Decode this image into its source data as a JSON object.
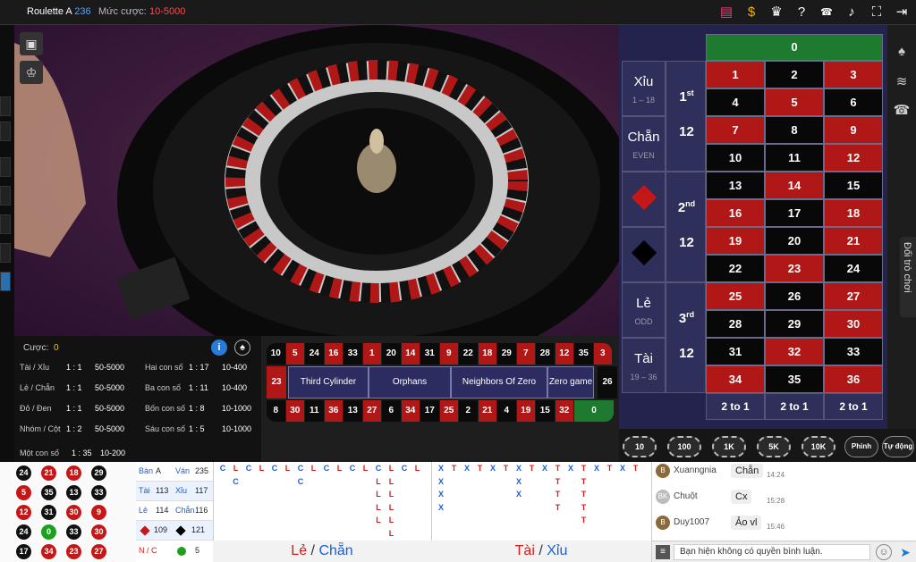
{
  "topbar": {
    "title": "Roulette A",
    "table_id": "236",
    "bet_label": "Mức cược:",
    "bet_range": "10-5000"
  },
  "betinfo": {
    "cuoc_label": "Cược:",
    "cuoc_value": "0",
    "rows": [
      {
        "name": "Tài / Xỉu",
        "ratio": "1 : 1",
        "range": "50-5000",
        "name2": "Hai con số",
        "ratio2": "1 : 17",
        "range2": "10-400"
      },
      {
        "name": "Lẻ / Chẵn",
        "ratio": "1 : 1",
        "range": "50-5000",
        "name2": "Ba con số",
        "ratio2": "1 : 11",
        "range2": "10-400"
      },
      {
        "name": "Đỏ / Đen",
        "ratio": "1 : 1",
        "range": "50-5000",
        "name2": "Bốn con số",
        "ratio2": "1 : 8",
        "range2": "10-1000"
      },
      {
        "name": "Nhóm / Cột",
        "ratio": "1 : 2",
        "range": "50-5000",
        "name2": "Sáu con số",
        "ratio2": "1 : 5",
        "range2": "10-1000"
      }
    ],
    "single": {
      "name": "Một con số",
      "ratio": "1 : 35",
      "range": "10-200"
    }
  },
  "racetrack": {
    "top": [
      "10",
      "5",
      "24",
      "16",
      "33",
      "1",
      "20",
      "14",
      "31",
      "9",
      "22",
      "18",
      "29",
      "7",
      "28",
      "12",
      "35",
      "3"
    ],
    "bottom": [
      "8",
      "30",
      "11",
      "36",
      "13",
      "27",
      "6",
      "34",
      "17",
      "25",
      "2",
      "21",
      "4",
      "19",
      "15",
      "32",
      "0"
    ],
    "left": "23",
    "right": "26",
    "sections": [
      "Third Cylinder",
      "Orphans",
      "Neighbors Of Zero",
      "Zero game"
    ]
  },
  "board": {
    "zero": "0",
    "sides": {
      "xiu": "Xỉu",
      "xiu_sub": "1 – 18",
      "chan": "Chẵn",
      "chan_sub": "EVEN",
      "le": "Lẻ",
      "le_sub": "ODD",
      "tai": "Tài",
      "tai_sub": "19 – 36"
    },
    "dozens": [
      {
        "ord": "1",
        "sup": "st",
        "n": "12"
      },
      {
        "ord": "2",
        "sup": "nd",
        "n": "12"
      },
      {
        "ord": "3",
        "sup": "rd",
        "n": "12"
      }
    ],
    "payout": "2 to 1"
  },
  "chips": [
    "10",
    "100",
    "1K",
    "5K",
    "10K"
  ],
  "chip_buttons": {
    "repeat": "Phinh",
    "auto": "Tự động"
  },
  "side_tab": "Đổi trò chơi",
  "history": {
    "stats": {
      "ban": "Bàn",
      "ban_v": "A",
      "van": "Ván",
      "van_v": "235",
      "tai": "Tài",
      "tai_v": "113",
      "xiu": "Xỉu",
      "xiu_v": "117",
      "le": "Lẻ",
      "le_v": "114",
      "chan": "Chẵn",
      "chan_v": "116",
      "red_v": "109",
      "black_v": "121",
      "nc": "N / C",
      "green_v": "5"
    },
    "label_left_a": "Lẻ",
    "label_left_sep": " / ",
    "label_left_b": "Chẵn",
    "label_right_a": "Tài",
    "label_right_sep": " / ",
    "label_right_b": "Xỉu"
  },
  "chat": {
    "messages": [
      {
        "avatar": "B",
        "user": "Xuanngnia",
        "msg": "Chẵn",
        "time": "14:24"
      },
      {
        "avatar": "BK",
        "user": "Chuột",
        "msg": "Cx",
        "time": "15:28"
      },
      {
        "avatar": "B",
        "user": "Duy1007",
        "msg": "Ảo vl",
        "time": "15:46"
      }
    ],
    "input_placeholder": "Bạn hiện không có quyền bình luận."
  },
  "colors": {
    "red": "#b01818",
    "black": "#080808",
    "green": "#1e7a2e",
    "board_bg": "#23234d",
    "accent": "#4aa8ff"
  }
}
